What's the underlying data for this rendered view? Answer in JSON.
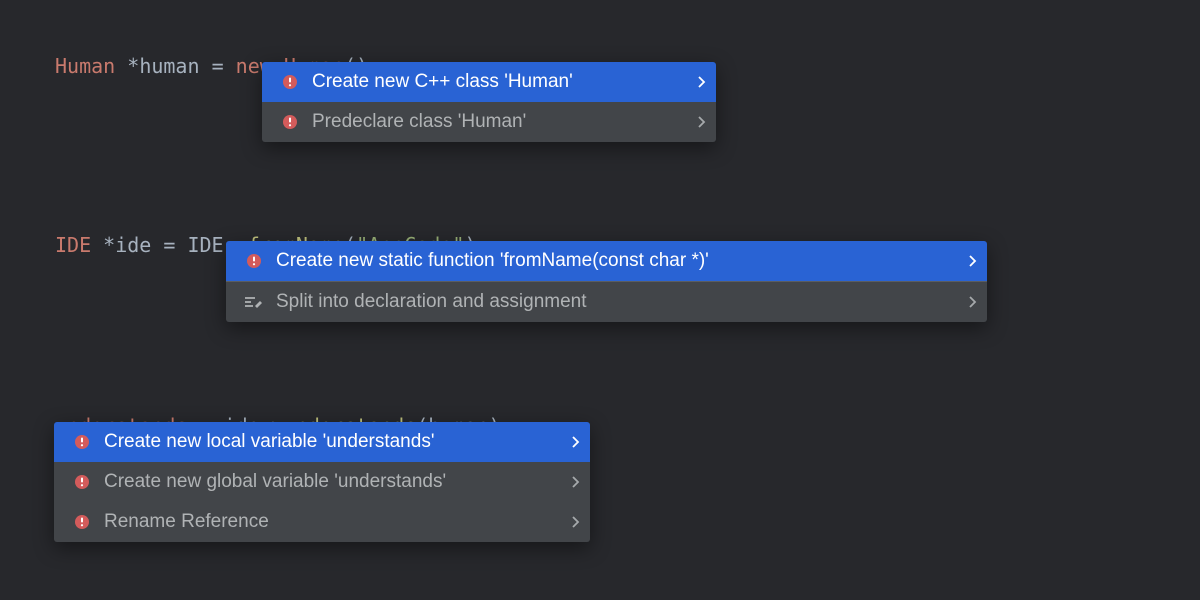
{
  "code": {
    "line1": {
      "type": "Human",
      "star": " *",
      "var": "human",
      "assign": " = ",
      "kw": "new ",
      "ctor": "Human",
      "parens": "()",
      "semi": ";"
    },
    "line2": {
      "type": "IDE",
      "star": " *",
      "var": "ide",
      "assign": " = ",
      "cls": "IDE",
      "scope": "::",
      "method": "fromName",
      "open": "(",
      "arg": "\"AppCode\"",
      "close": ")",
      "semi": ";"
    },
    "line3": {
      "lhs": "understands",
      "assign": " = ",
      "obj": "ide",
      "arrow": "->",
      "method": "understands",
      "open": "(",
      "arg": "human",
      "close": ")",
      "semi": ";"
    }
  },
  "popup1": {
    "item0": "Create new C++ class 'Human'",
    "item1": "Predeclare class 'Human'"
  },
  "popup2": {
    "item0": "Create new static function 'fromName(const char *)'",
    "item1": "Split into declaration and assignment"
  },
  "popup3": {
    "item0": "Create new local variable 'understands'",
    "item1": "Create new global variable 'understands'",
    "item2": "Rename Reference"
  }
}
